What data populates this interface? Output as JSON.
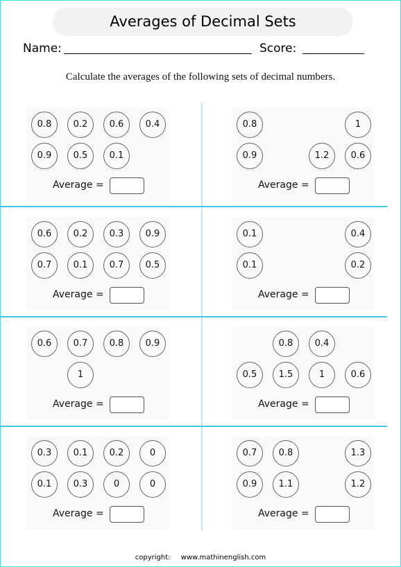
{
  "title": "Averages of Decimal Sets",
  "name_label": "Name:",
  "score_label": "Score:",
  "instructions": "Calculate the averages of the following sets of decimal numbers.",
  "average_label": "Average =",
  "problems": [
    {
      "id": 1,
      "rows": [
        [
          "0.8",
          "0.2",
          "0.6",
          "0.4"
        ],
        [
          "0.9",
          "0.5",
          "0.1",
          ""
        ]
      ],
      "answer": ""
    },
    {
      "id": 2,
      "rows": [
        [
          "0.8",
          "",
          "",
          "1"
        ],
        [
          "0.9",
          "",
          "1.2",
          "0.6"
        ]
      ],
      "answer": ""
    },
    {
      "id": 3,
      "rows": [
        [
          "0.6",
          "0.2",
          "0.3",
          "0.9"
        ],
        [
          "0.7",
          "0.1",
          "0.7",
          "0.5"
        ]
      ],
      "answer": ""
    },
    {
      "id": 4,
      "rows": [
        [
          "0.1",
          "",
          "",
          "0.4"
        ],
        [
          "0.1",
          "",
          "",
          "0.2"
        ]
      ],
      "answer": ""
    },
    {
      "id": 5,
      "rows": [
        [
          "0.6",
          "0.7",
          "0.8",
          "0.9"
        ],
        [
          "",
          "1",
          "",
          ""
        ]
      ],
      "answer": ""
    },
    {
      "id": 6,
      "rows": [
        [
          "",
          "0.8",
          "0.4",
          ""
        ],
        [
          "0.5",
          "1.5",
          "1",
          "0.6"
        ]
      ],
      "answer": ""
    },
    {
      "id": 7,
      "rows": [
        [
          "0.3",
          "0.1",
          "0.2",
          "0"
        ],
        [
          "0.1",
          "0.3",
          "0",
          "0"
        ]
      ],
      "answer": ""
    },
    {
      "id": 8,
      "rows": [
        [
          "0.7",
          "0.8",
          "",
          "1.3"
        ],
        [
          "0.9",
          "1.1",
          "",
          "1.2"
        ]
      ],
      "answer": ""
    }
  ],
  "footer": {
    "copyright_label": "copyright:",
    "website": "www.mathinenglish.com"
  }
}
